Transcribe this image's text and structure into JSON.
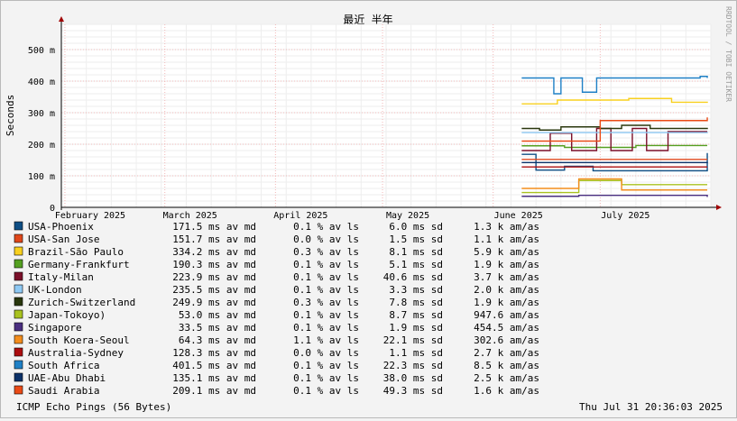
{
  "chart_data": {
    "type": "line",
    "title": "最近 半年",
    "ylabel": "Seconds",
    "watermark": "RRDTOOL / TOBI OETIKER",
    "ylim": [
      0,
      0.58
    ],
    "y_ticks": [
      {
        "value": 0,
        "label": "0"
      },
      {
        "value": 0.1,
        "label": "100 m"
      },
      {
        "value": 0.2,
        "label": "200 m"
      },
      {
        "value": 0.3,
        "label": "300 m"
      },
      {
        "value": 0.4,
        "label": "400 m"
      },
      {
        "value": 0.5,
        "label": "500 m"
      }
    ],
    "xlim": [
      "2025-01-31",
      "2025-08-01"
    ],
    "x_ticks": [
      {
        "date": "2025-02-01",
        "label": "February 2025"
      },
      {
        "date": "2025-03-01",
        "label": "March 2025"
      },
      {
        "date": "2025-04-01",
        "label": "April 2025"
      },
      {
        "date": "2025-05-01",
        "label": "May 2025"
      },
      {
        "date": "2025-06-01",
        "label": "June 2025"
      },
      {
        "date": "2025-07-01",
        "label": "July 2025"
      }
    ],
    "data_start": "2025-06-09",
    "data_end": "2025-07-31",
    "series": [
      {
        "name": "USA-Phoenix",
        "color": "#0e4e84",
        "avg": "171.5 ms av md",
        "loss": "0.1 % av ls",
        "sd": "6.0 ms sd",
        "amas": "1.3 k am/as",
        "points": [
          [
            "2025-06-09",
            0.168
          ],
          [
            "2025-06-12",
            0.168
          ],
          [
            "2025-06-13",
            0.118
          ],
          [
            "2025-06-20",
            0.118
          ],
          [
            "2025-06-21",
            0.13
          ],
          [
            "2025-06-28",
            0.13
          ],
          [
            "2025-06-29",
            0.116
          ],
          [
            "2025-07-31",
            0.172
          ]
        ]
      },
      {
        "name": "USA-San Jose",
        "color": "#e0471b",
        "avg": "151.7 ms av md",
        "loss": "0.0 % av ls",
        "sd": "1.5 ms sd",
        "amas": "1.1 k am/as",
        "points": [
          [
            "2025-06-09",
            0.152
          ],
          [
            "2025-07-31",
            0.152
          ]
        ]
      },
      {
        "name": "Brazil-São Paulo",
        "color": "#f8d01f",
        "avg": "334.2 ms av md",
        "loss": "0.3 % av ls",
        "sd": "8.1 ms sd",
        "amas": "5.9 k am/as",
        "points": [
          [
            "2025-06-09",
            0.328
          ],
          [
            "2025-06-18",
            0.328
          ],
          [
            "2025-06-19",
            0.34
          ],
          [
            "2025-07-08",
            0.34
          ],
          [
            "2025-07-09",
            0.345
          ],
          [
            "2025-07-20",
            0.345
          ],
          [
            "2025-07-21",
            0.333
          ],
          [
            "2025-07-31",
            0.335
          ]
        ]
      },
      {
        "name": "Germany-Frankfurt",
        "color": "#54a021",
        "avg": "190.3 ms av md",
        "loss": "0.1 % av ls",
        "sd": "5.1 ms sd",
        "amas": "1.9 k am/as",
        "points": [
          [
            "2025-06-09",
            0.195
          ],
          [
            "2025-06-20",
            0.195
          ],
          [
            "2025-06-21",
            0.19
          ],
          [
            "2025-07-10",
            0.19
          ],
          [
            "2025-07-11",
            0.196
          ],
          [
            "2025-07-31",
            0.196
          ]
        ]
      },
      {
        "name": "Italy-Milan",
        "color": "#7a0f29",
        "avg": "223.9 ms av md",
        "loss": "0.1 % av ls",
        "sd": "40.6 ms sd",
        "amas": "3.7 k am/as",
        "points": [
          [
            "2025-06-09",
            0.18
          ],
          [
            "2025-06-16",
            0.18
          ],
          [
            "2025-06-17",
            0.235
          ],
          [
            "2025-06-22",
            0.235
          ],
          [
            "2025-06-23",
            0.18
          ],
          [
            "2025-06-29",
            0.18
          ],
          [
            "2025-06-30",
            0.25
          ],
          [
            "2025-07-04",
            0.18
          ],
          [
            "2025-07-10",
            0.25
          ],
          [
            "2025-07-14",
            0.18
          ],
          [
            "2025-07-20",
            0.24
          ],
          [
            "2025-07-31",
            0.24
          ]
        ]
      },
      {
        "name": "UK-London",
        "color": "#8ec9f4",
        "avg": "235.5 ms av md",
        "loss": "0.1 % av ls",
        "sd": "3.3 ms sd",
        "amas": "2.0 k am/as",
        "points": [
          [
            "2025-06-09",
            0.237
          ],
          [
            "2025-07-31",
            0.235
          ]
        ]
      },
      {
        "name": "Zurich-Switzerland",
        "color": "#29370d",
        "avg": "249.9 ms av md",
        "loss": "0.3 % av ls",
        "sd": "7.8 ms sd",
        "amas": "1.9 k am/as",
        "points": [
          [
            "2025-06-09",
            0.25
          ],
          [
            "2025-06-14",
            0.245
          ],
          [
            "2025-06-20",
            0.255
          ],
          [
            "2025-07-01",
            0.25
          ],
          [
            "2025-07-07",
            0.26
          ],
          [
            "2025-07-15",
            0.25
          ],
          [
            "2025-07-31",
            0.252
          ]
        ]
      },
      {
        "name": "Japan-Tokoyo)",
        "color": "#a9c21f",
        "avg": "53.0 ms av md",
        "loss": "0.1 % av ls",
        "sd": "8.7 ms sd",
        "amas": "947.6   am/as",
        "points": [
          [
            "2025-06-09",
            0.047
          ],
          [
            "2025-06-24",
            0.047
          ],
          [
            "2025-06-25",
            0.085
          ],
          [
            "2025-07-06",
            0.085
          ],
          [
            "2025-07-07",
            0.072
          ],
          [
            "2025-07-31",
            0.072
          ]
        ]
      },
      {
        "name": "Singapore",
        "color": "#4a2f80",
        "avg": "33.5 ms av md",
        "loss": "0.1 % av ls",
        "sd": "1.9 ms sd",
        "amas": "454.5   am/as",
        "points": [
          [
            "2025-06-09",
            0.035
          ],
          [
            "2025-06-24",
            0.035
          ],
          [
            "2025-06-25",
            0.038
          ],
          [
            "2025-07-31",
            0.033
          ]
        ]
      },
      {
        "name": "South Koera-Seoul",
        "color": "#f38d1d",
        "avg": "64.3 ms av md",
        "loss": "1.1 % av ls",
        "sd": "22.1 ms sd",
        "amas": "302.6   am/as",
        "points": [
          [
            "2025-06-09",
            0.06
          ],
          [
            "2025-06-24",
            0.06
          ],
          [
            "2025-06-25",
            0.09
          ],
          [
            "2025-07-06",
            0.09
          ],
          [
            "2025-07-07",
            0.055
          ],
          [
            "2025-07-31",
            0.055
          ]
        ]
      },
      {
        "name": "Australia-Sydney",
        "color": "#ac0d0f",
        "avg": "128.3 ms av md",
        "loss": "0.0 % av ls",
        "sd": "1.1 ms sd",
        "amas": "2.7 k am/as",
        "points": [
          [
            "2025-06-09",
            0.128
          ],
          [
            "2025-07-31",
            0.128
          ]
        ]
      },
      {
        "name": "South Africa",
        "color": "#1f80c6",
        "avg": "401.5 ms av md",
        "loss": "0.1 % av ls",
        "sd": "22.3 ms sd",
        "amas": "8.5 k am/as",
        "points": [
          [
            "2025-06-09",
            0.41
          ],
          [
            "2025-06-17",
            0.41
          ],
          [
            "2025-06-18",
            0.36
          ],
          [
            "2025-06-20",
            0.41
          ],
          [
            "2025-06-25",
            0.41
          ],
          [
            "2025-06-26",
            0.365
          ],
          [
            "2025-06-29",
            0.365
          ],
          [
            "2025-06-30",
            0.41
          ],
          [
            "2025-07-29",
            0.415
          ],
          [
            "2025-07-31",
            0.41
          ]
        ]
      },
      {
        "name": "UAE-Abu Dhabi",
        "color": "#0d326a",
        "avg": "135.1 ms av md",
        "loss": "0.1 % av ls",
        "sd": "38.0 ms sd",
        "amas": "2.5 k am/as",
        "points": [
          [
            "2025-06-09",
            0.142
          ],
          [
            "2025-07-31",
            0.14
          ]
        ]
      },
      {
        "name": "Saudi Arabia",
        "color": "#ea4a16",
        "avg": "209.1 ms av md",
        "loss": "0.1 % av ls",
        "sd": "49.3 ms sd",
        "amas": "1.6 k am/as",
        "points": [
          [
            "2025-06-09",
            0.21
          ],
          [
            "2025-06-30",
            0.21
          ],
          [
            "2025-07-01",
            0.275
          ],
          [
            "2025-07-31",
            0.285
          ]
        ]
      }
    ]
  },
  "footer": {
    "left": "ICMP Echo Pings (56 Bytes)",
    "right": "Thu Jul 31 20:36:03 2025"
  }
}
